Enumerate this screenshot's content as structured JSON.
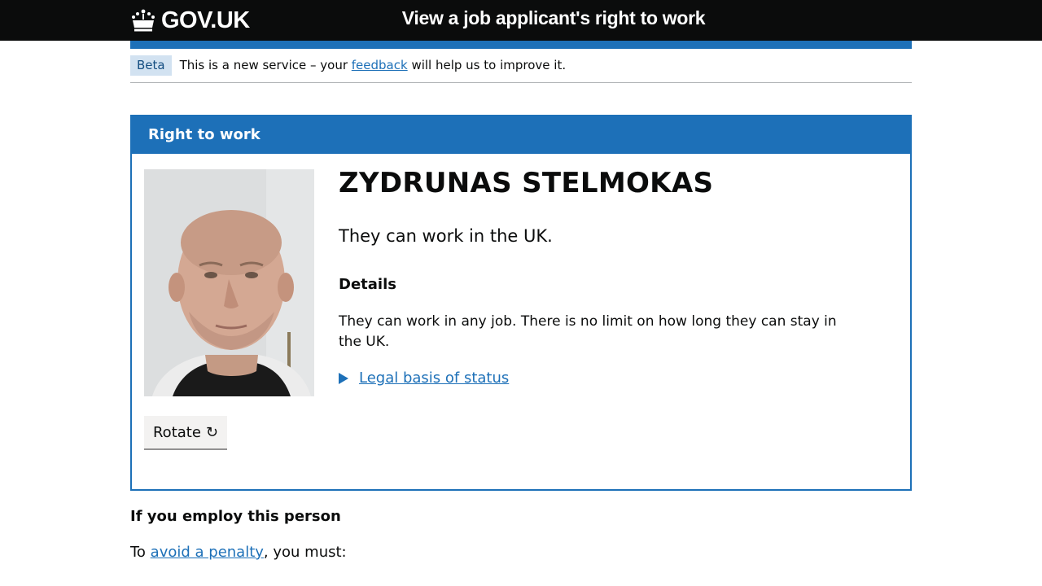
{
  "header": {
    "logo_text": "GOV.UK",
    "service_name": "View a job applicant's right to work"
  },
  "phase_banner": {
    "tag": "Beta",
    "text_before": "This is a new service – your ",
    "link": "feedback",
    "text_after": " will help us to improve it."
  },
  "panel": {
    "title": "Right to work",
    "name": "ZYDRUNAS STELMOKAS",
    "status": "They can work in the UK.",
    "details_heading": "Details",
    "details_text": "They can work in any job. There is no limit on how long they can stay in the UK.",
    "legal_link": "Legal basis of status",
    "rotate_label": "Rotate",
    "rotate_icon": "↻"
  },
  "employer": {
    "heading": "If you employ this person",
    "text_before": "To ",
    "link": "avoid a penalty",
    "text_after": ", you must:"
  },
  "colors": {
    "header_bg": "#0b0c0c",
    "brand_blue": "#1d70b8",
    "phase_tag_bg": "#d2e2f1",
    "button_bg": "#f3f2f1"
  }
}
